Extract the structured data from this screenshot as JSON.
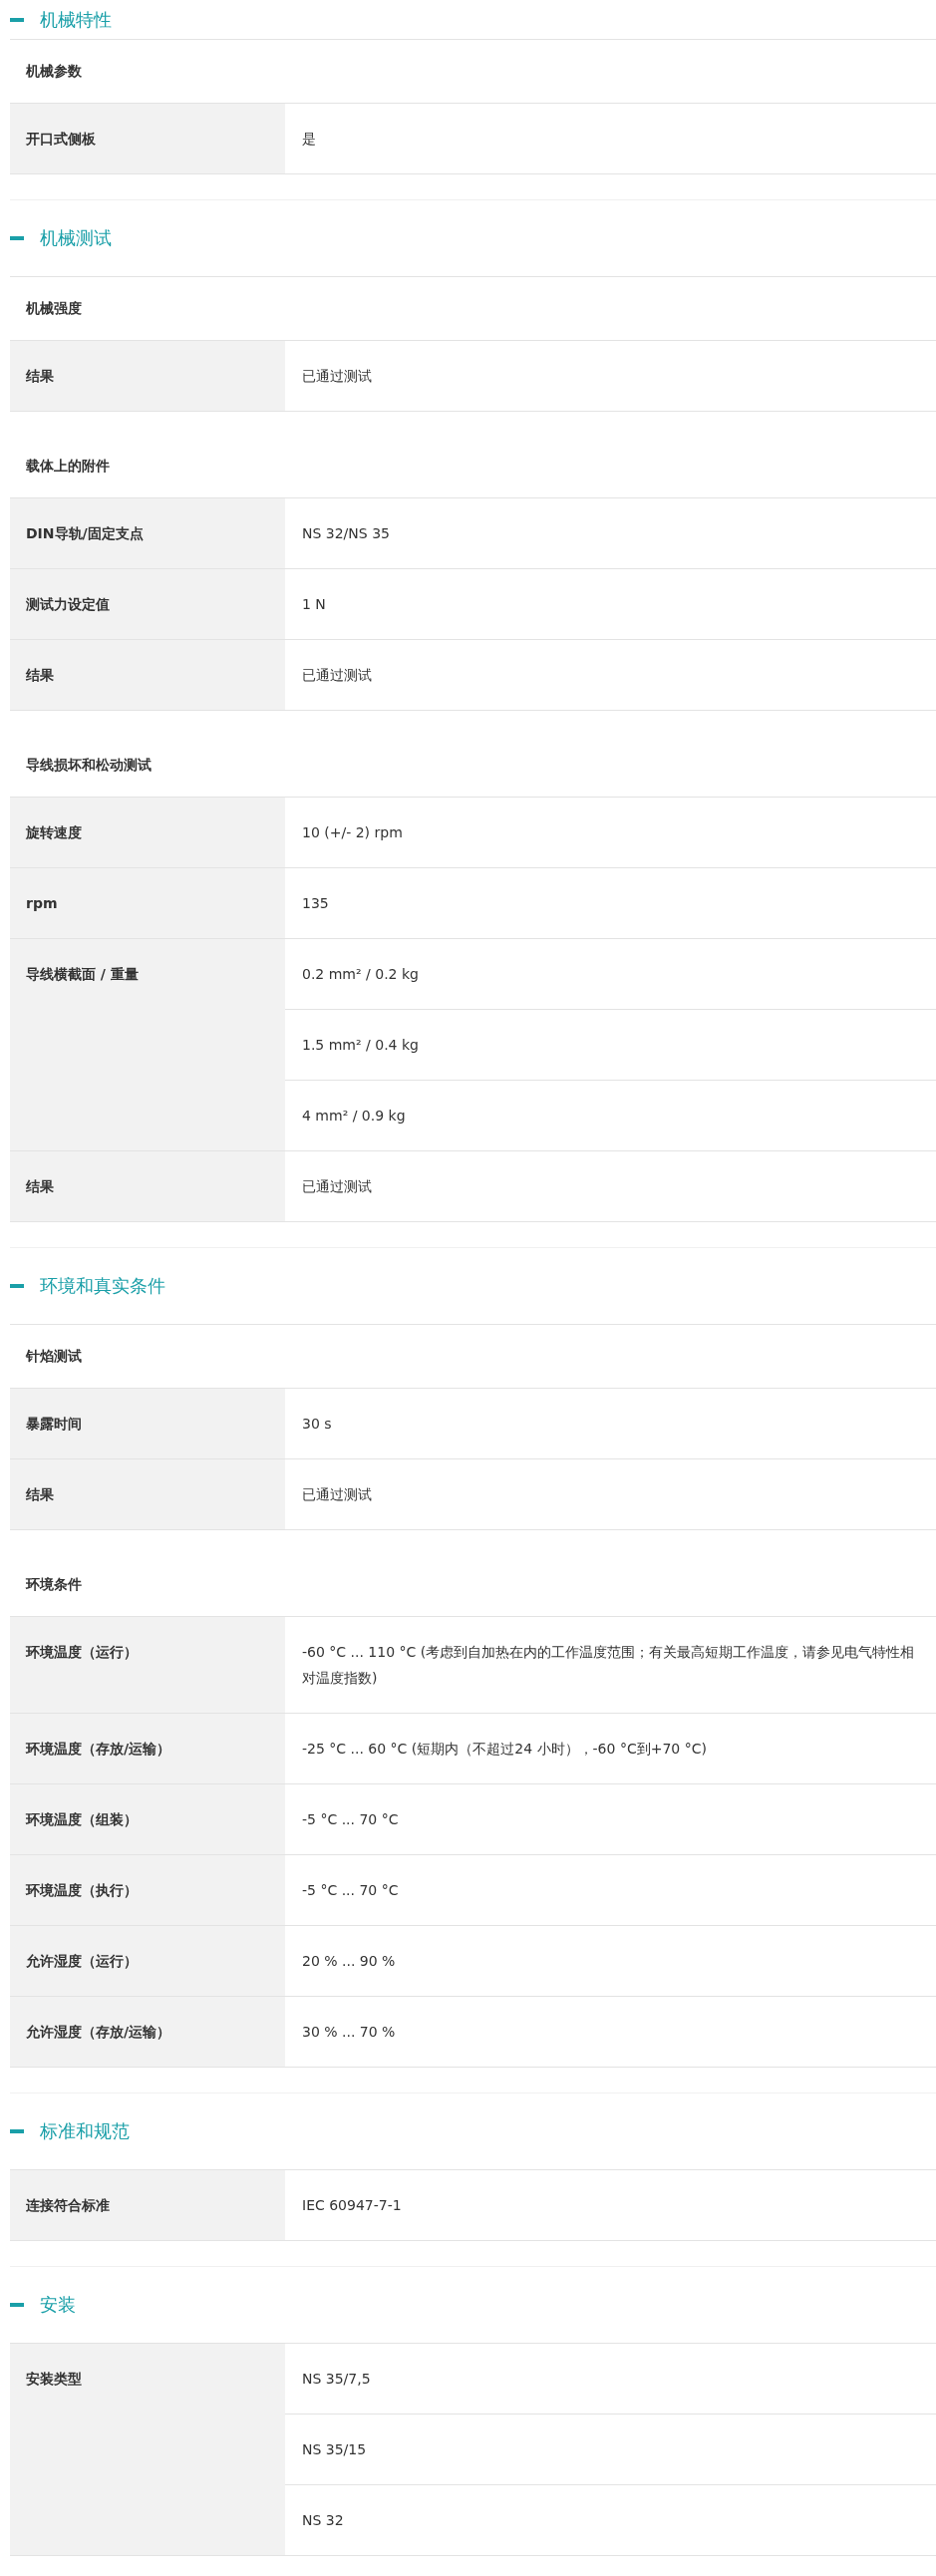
{
  "sections": [
    {
      "title": "机械特性",
      "expanded": true,
      "groups": [
        {
          "title": "机械参数",
          "rows": [
            {
              "label": "开口式侧板",
              "values": [
                "是"
              ]
            }
          ]
        }
      ]
    },
    {
      "title": "机械测试",
      "expanded": true,
      "groups": [
        {
          "title": "机械强度",
          "rows": [
            {
              "label": "结果",
              "values": [
                "已通过测试"
              ]
            }
          ]
        },
        {
          "title": "载体上的附件",
          "rows": [
            {
              "label": "DIN导轨/固定支点",
              "values": [
                "NS 32/NS 35"
              ]
            },
            {
              "label": "测试力设定值",
              "values": [
                "1 N"
              ]
            },
            {
              "label": "结果",
              "values": [
                "已通过测试"
              ]
            }
          ]
        },
        {
          "title": "导线损坏和松动测试",
          "rows": [
            {
              "label": "旋转速度",
              "values": [
                "10 (+/- 2) rpm"
              ]
            },
            {
              "label": "rpm",
              "values": [
                "135"
              ]
            },
            {
              "label": "导线横截面 / 重量",
              "values": [
                "0.2 mm² / 0.2 kg",
                "1.5 mm² / 0.4 kg",
                "4 mm² / 0.9 kg"
              ]
            },
            {
              "label": "结果",
              "values": [
                "已通过测试"
              ]
            }
          ]
        }
      ]
    },
    {
      "title": "环境和真实条件",
      "expanded": true,
      "groups": [
        {
          "title": "针焰测试",
          "rows": [
            {
              "label": "暴露时间",
              "values": [
                "30 s"
              ]
            },
            {
              "label": "结果",
              "values": [
                "已通过测试"
              ]
            }
          ]
        },
        {
          "title": "环境条件",
          "rows": [
            {
              "label": "环境温度（运行）",
              "values": [
                "-60 °C ... 110 °C (考虑到自加热在内的工作温度范围；有关最高短期工作温度，请参见电气特性相对温度指数)"
              ]
            },
            {
              "label": "环境温度（存放/运输）",
              "values": [
                "-25 °C ... 60 °C (短期内（不超过24  小时），-60 °C到+70 °C)"
              ]
            },
            {
              "label": "环境温度（组装）",
              "values": [
                "-5 °C ... 70 °C"
              ]
            },
            {
              "label": "环境温度（执行）",
              "values": [
                "-5 °C ... 70 °C"
              ]
            },
            {
              "label": "允许湿度（运行）",
              "values": [
                "20 % ... 90 %"
              ]
            },
            {
              "label": "允许湿度（存放/运输）",
              "values": [
                "30 % ... 70 %"
              ]
            }
          ]
        }
      ]
    },
    {
      "title": "标准和规范",
      "expanded": true,
      "groups": [
        {
          "rows": [
            {
              "label": "连接符合标准",
              "values": [
                "IEC 60947-7-1"
              ]
            }
          ]
        }
      ]
    },
    {
      "title": "安装",
      "expanded": true,
      "groups": [
        {
          "rows": [
            {
              "label": "安装类型",
              "values": [
                "NS 35/7,5",
                "NS 35/15",
                "NS 32"
              ]
            }
          ]
        }
      ]
    }
  ]
}
